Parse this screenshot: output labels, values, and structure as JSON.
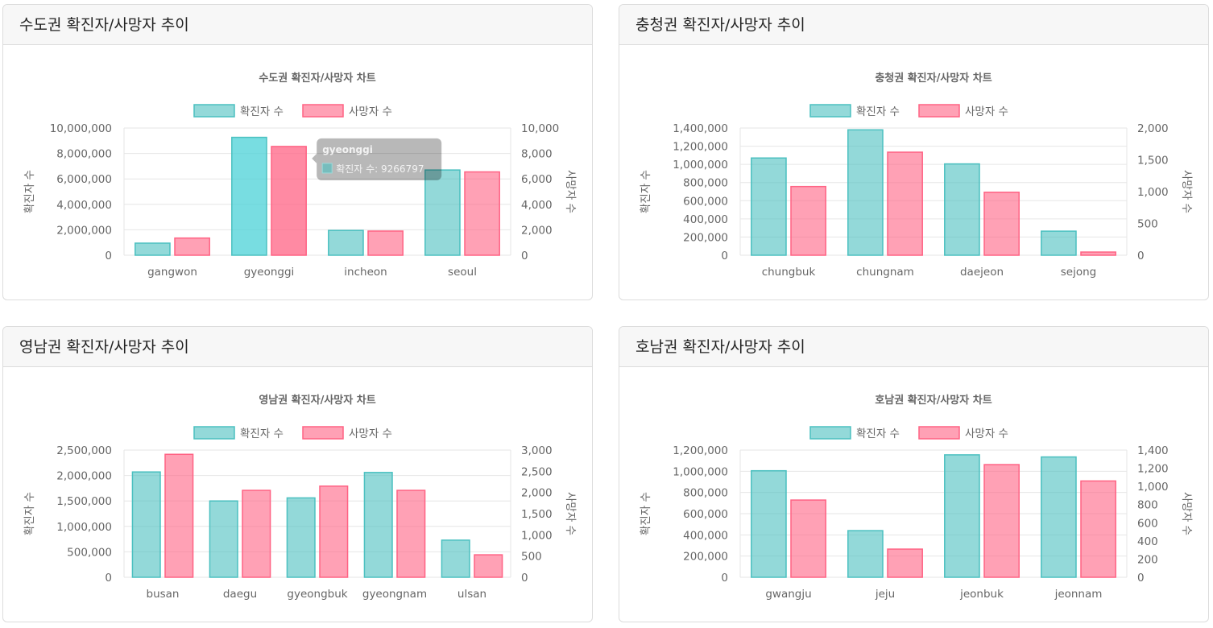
{
  "colors": {
    "confirmed_fill": "rgba(75,192,192,0.6)",
    "confirmed_border": "#4bc0c0",
    "death_fill": "rgba(255,99,132,0.6)",
    "death_border": "#ff6384"
  },
  "cards": [
    {
      "header": "수도권 확진자/사망자 추이"
    },
    {
      "header": "충청권 확진자/사망자 추이"
    },
    {
      "header": "영남권 확진자/사망자 추이"
    },
    {
      "header": "호남권 확진자/사망자 추이"
    }
  ],
  "chart_data": [
    {
      "type": "bar",
      "title": "수도권 확진자/사망자 차트",
      "categories": [
        "gangwon",
        "gyeonggi",
        "incheon",
        "seoul"
      ],
      "series": [
        {
          "name": "확진자 수",
          "axis": "left",
          "values": [
            950000,
            9266797,
            1950000,
            6700000
          ]
        },
        {
          "name": "사망자 수",
          "axis": "right",
          "values": [
            1350,
            8550,
            1900,
            6550
          ]
        }
      ],
      "ylabel_left": "확진자 수",
      "ylabel_right": "사망자 수",
      "ylim_left": [
        0,
        10000000
      ],
      "ylim_right": [
        0,
        10000
      ],
      "yticks_left": [
        "0",
        "2,000,000",
        "4,000,000",
        "6,000,000",
        "8,000,000",
        "10,000,000"
      ],
      "yticks_right": [
        "0",
        "2,000",
        "4,000",
        "6,000",
        "8,000",
        "10,000"
      ],
      "legend": "top",
      "hover_index": 1,
      "tooltip": {
        "title": "gyeonggi",
        "body": "확진자 수: 9266797"
      }
    },
    {
      "type": "bar",
      "title": "충청권 확진자/사망자 차트",
      "categories": [
        "chungbuk",
        "chungnam",
        "daejeon",
        "sejong"
      ],
      "series": [
        {
          "name": "확진자 수",
          "axis": "left",
          "values": [
            1070000,
            1380000,
            1005000,
            265000
          ]
        },
        {
          "name": "사망자 수",
          "axis": "right",
          "values": [
            1080,
            1620,
            990,
            50
          ]
        }
      ],
      "ylabel_left": "확진자 수",
      "ylabel_right": "사망자 수",
      "ylim_left": [
        0,
        1400000
      ],
      "ylim_right": [
        0,
        2000
      ],
      "yticks_left": [
        "0",
        "200,000",
        "400,000",
        "600,000",
        "800,000",
        "1,000,000",
        "1,200,000",
        "1,400,000"
      ],
      "yticks_right": [
        "0",
        "500",
        "1,000",
        "1,500",
        "2,000"
      ],
      "legend": "top"
    },
    {
      "type": "bar",
      "title": "영남권 확진자/사망자 차트",
      "categories": [
        "busan",
        "daegu",
        "gyeongbuk",
        "gyeongnam",
        "ulsan"
      ],
      "series": [
        {
          "name": "확진자 수",
          "axis": "left",
          "values": [
            2070000,
            1500000,
            1560000,
            2060000,
            730000
          ]
        },
        {
          "name": "사망자 수",
          "axis": "right",
          "values": [
            2900,
            2050,
            2150,
            2050,
            530
          ]
        }
      ],
      "ylabel_left": "확진자 수",
      "ylabel_right": "사망자 수",
      "ylim_left": [
        0,
        2500000
      ],
      "ylim_right": [
        0,
        3000
      ],
      "yticks_left": [
        "0",
        "500,000",
        "1,000,000",
        "1,500,000",
        "2,000,000",
        "2,500,000"
      ],
      "yticks_right": [
        "0",
        "500",
        "1,000",
        "1,500",
        "2,000",
        "2,500",
        "3,000"
      ],
      "legend": "top"
    },
    {
      "type": "bar",
      "title": "호남권 확진자/사망자 차트",
      "categories": [
        "gwangju",
        "jeju",
        "jeonbuk",
        "jeonnam"
      ],
      "series": [
        {
          "name": "확진자 수",
          "axis": "left",
          "values": [
            1005000,
            440000,
            1155000,
            1135000
          ]
        },
        {
          "name": "사망자 수",
          "axis": "right",
          "values": [
            850,
            310,
            1240,
            1060
          ]
        }
      ],
      "ylabel_left": "확진자 수",
      "ylabel_right": "사망자 수",
      "ylim_left": [
        0,
        1200000
      ],
      "ylim_right": [
        0,
        1400
      ],
      "yticks_left": [
        "0",
        "200,000",
        "400,000",
        "600,000",
        "800,000",
        "1,000,000",
        "1,200,000"
      ],
      "yticks_right": [
        "0",
        "200",
        "400",
        "600",
        "800",
        "1,000",
        "1,200",
        "1,400"
      ],
      "legend": "top"
    }
  ]
}
